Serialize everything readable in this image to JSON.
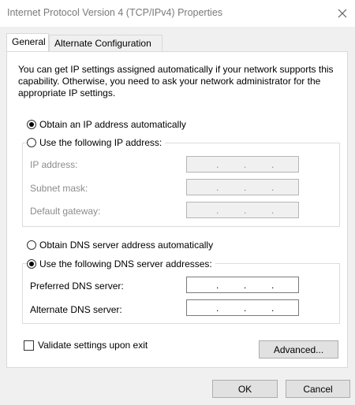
{
  "window": {
    "title": "Internet Protocol Version 4 (TCP/IPv4) Properties"
  },
  "tabs": [
    {
      "label": "General",
      "active": true
    },
    {
      "label": "Alternate Configuration",
      "active": false
    }
  ],
  "intro_text": "You can get IP settings assigned automatically if your network supports this capability. Otherwise, you need to ask your network administrator for the appropriate IP settings.",
  "ip_section": {
    "auto_label": "Obtain an IP address automatically",
    "manual_label": "Use the following IP address:",
    "selected": "auto",
    "fields": [
      {
        "label": "IP address:",
        "value": ". . .",
        "enabled": false
      },
      {
        "label": "Subnet mask:",
        "value": ". . .",
        "enabled": false
      },
      {
        "label": "Default gateway:",
        "value": ". . .",
        "enabled": false
      }
    ]
  },
  "dns_section": {
    "auto_label": "Obtain DNS server address automatically",
    "manual_label": "Use the following DNS server addresses:",
    "selected": "manual",
    "fields": [
      {
        "label": "Preferred DNS server:",
        "value": ". . .",
        "enabled": true
      },
      {
        "label": "Alternate DNS server:",
        "value": ". . .",
        "enabled": true
      }
    ]
  },
  "validate_label": "Validate settings upon exit",
  "buttons": {
    "advanced": "Advanced...",
    "ok": "OK",
    "cancel": "Cancel"
  },
  "icons": {
    "close": "close-icon"
  }
}
